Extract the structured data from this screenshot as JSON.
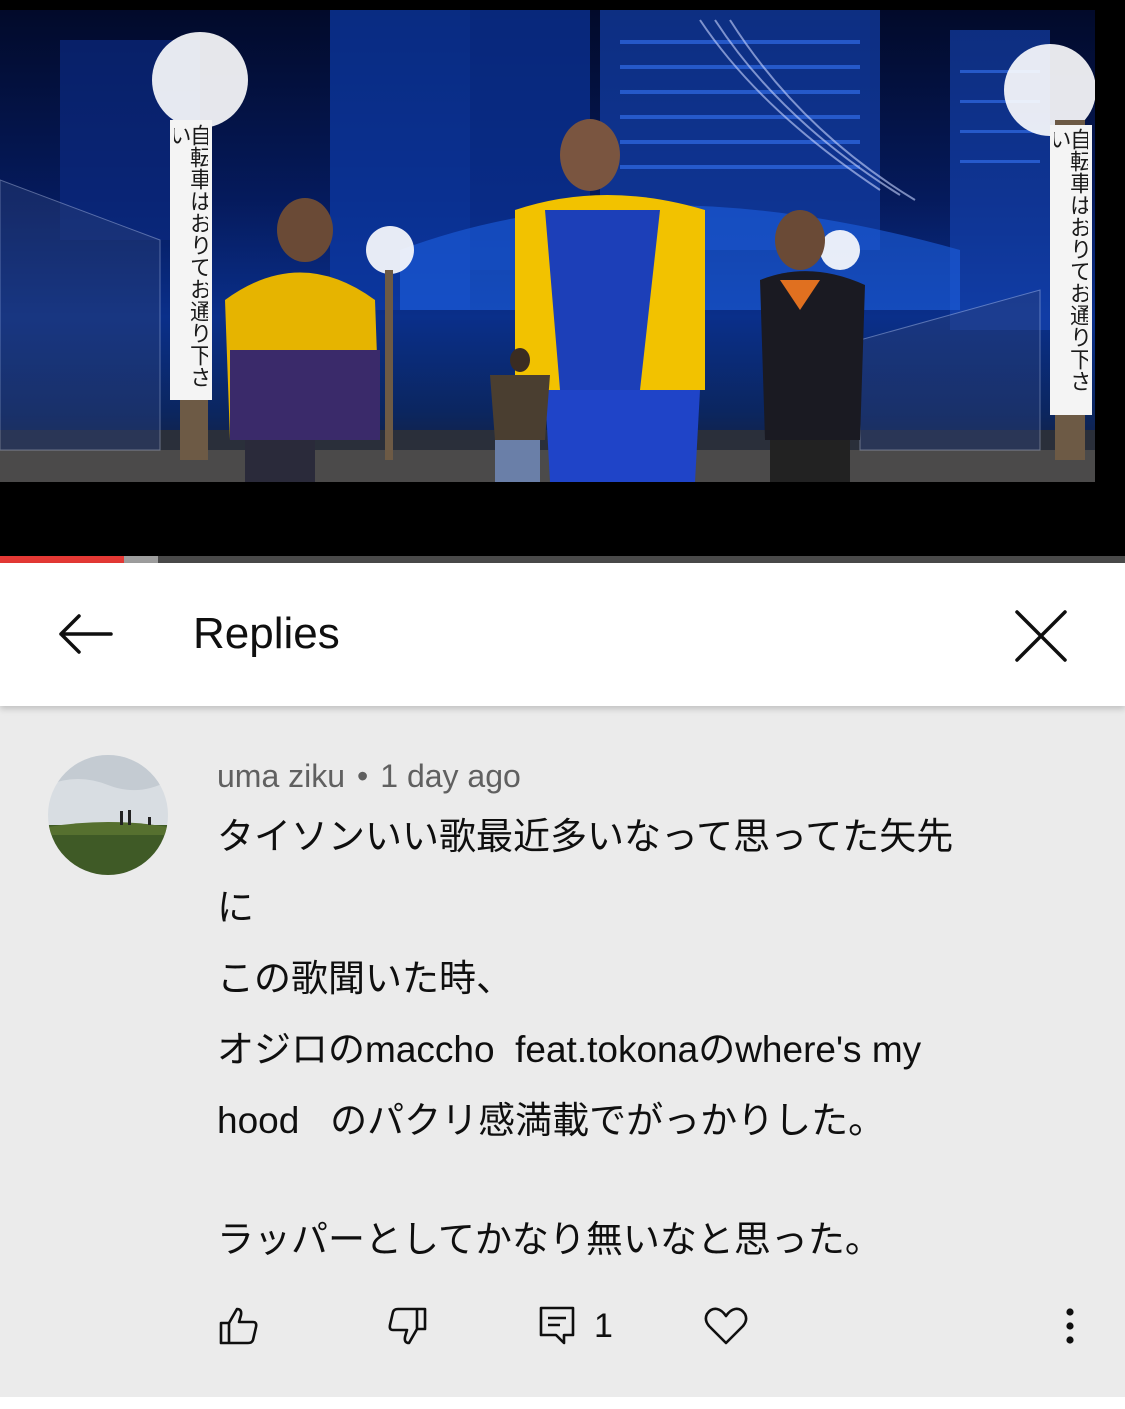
{
  "video": {
    "signs": {
      "left": "自転車はおりてお通り下さい",
      "right": "自転車はおりてお通り下さい"
    },
    "progress": {
      "played_fraction": 0.11,
      "buffered_fraction": 0.14
    }
  },
  "header": {
    "title": "Replies",
    "back_icon": "arrow-left-icon",
    "close_icon": "close-icon"
  },
  "comment": {
    "author": "uma ziku",
    "separator": "•",
    "time": "1 day ago",
    "lines": [
      "タイソンいい歌最近多いなって思ってた矢先",
      "に",
      "この歌聞いた時、",
      "オジロのmaccho  feat.tokonaのwhere's my",
      "hood   のパクリ感満載でがっかりした。"
    ],
    "last_line": "ラッパーとしてかなり無いなと思った。",
    "reply_count": "1"
  },
  "colors": {
    "progress_played": "#e53935",
    "comment_background": "#ebebeb",
    "meta_text": "#606060"
  }
}
